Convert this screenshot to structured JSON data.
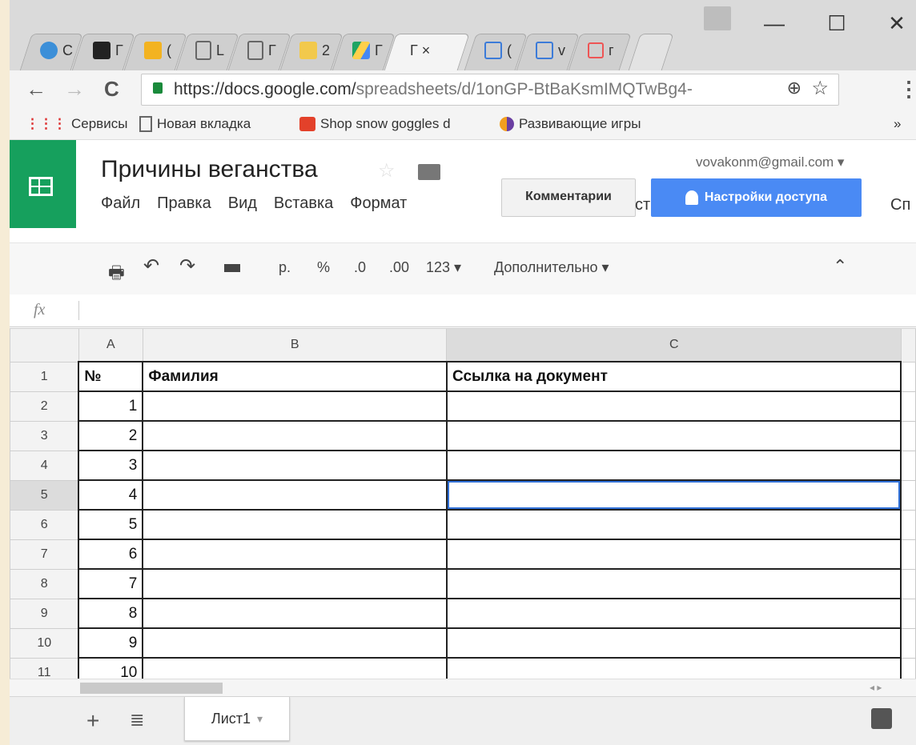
{
  "browser": {
    "tabs": [
      "С",
      "Г",
      "(",
      "L",
      "Г",
      "2",
      "Г",
      "Г",
      "(",
      "v",
      "г"
    ],
    "active_tab_label": "Г ×",
    "url_main": "https://docs.google.com/",
    "url_path": "spreadsheets/d/1onGP-BtBaKsmIMQTwBg4-",
    "back": "←",
    "forward": "→",
    "reload": "C",
    "minimize": "—",
    "maximize": "☐",
    "close": "✕",
    "zoom_icon": "⊕",
    "star_icon": "☆",
    "menu_icon": "⋮"
  },
  "bookmarks": {
    "items": [
      "Сервисы",
      "Новая вкладка",
      "Shop snow goggles d",
      "Развивающие игры"
    ],
    "more": "»"
  },
  "sheets": {
    "title": "Причины веганства",
    "account": "vovakonm@gmail.com ▾",
    "menu": [
      "Файл",
      "Правка",
      "Вид",
      "Вставка",
      "Формат"
    ],
    "comments_label": "Комментарии",
    "share_label": "Настройки доступа",
    "menu_tail": "Сп",
    "toolbar": {
      "currency": "р.",
      "percent": "%",
      "dec_less": ".0",
      "dec_more": ".00",
      "format_123": "123 ▾",
      "more_label": "Дополнительно ▾",
      "collapse": "⌃"
    },
    "fx_label": "fx",
    "columns": [
      "A",
      "B",
      "C"
    ],
    "header_row": [
      "№",
      "Фамилия",
      "Ссылка на документ"
    ],
    "row_numbers": [
      "1",
      "2",
      "3",
      "4",
      "5",
      "6",
      "7",
      "8",
      "9",
      "10",
      "11"
    ],
    "values": [
      "1",
      "2",
      "3",
      "4",
      "5",
      "6",
      "7",
      "8",
      "9",
      "10"
    ],
    "sheet_tab": "Лист1",
    "add_sheet": "+",
    "all_sheets": "≣",
    "sheet_tab_arrow": "▾"
  },
  "colors": {
    "sheets_green": "#16a05d",
    "share_blue": "#4a8af4",
    "selection_blue": "#2f6fd6"
  }
}
